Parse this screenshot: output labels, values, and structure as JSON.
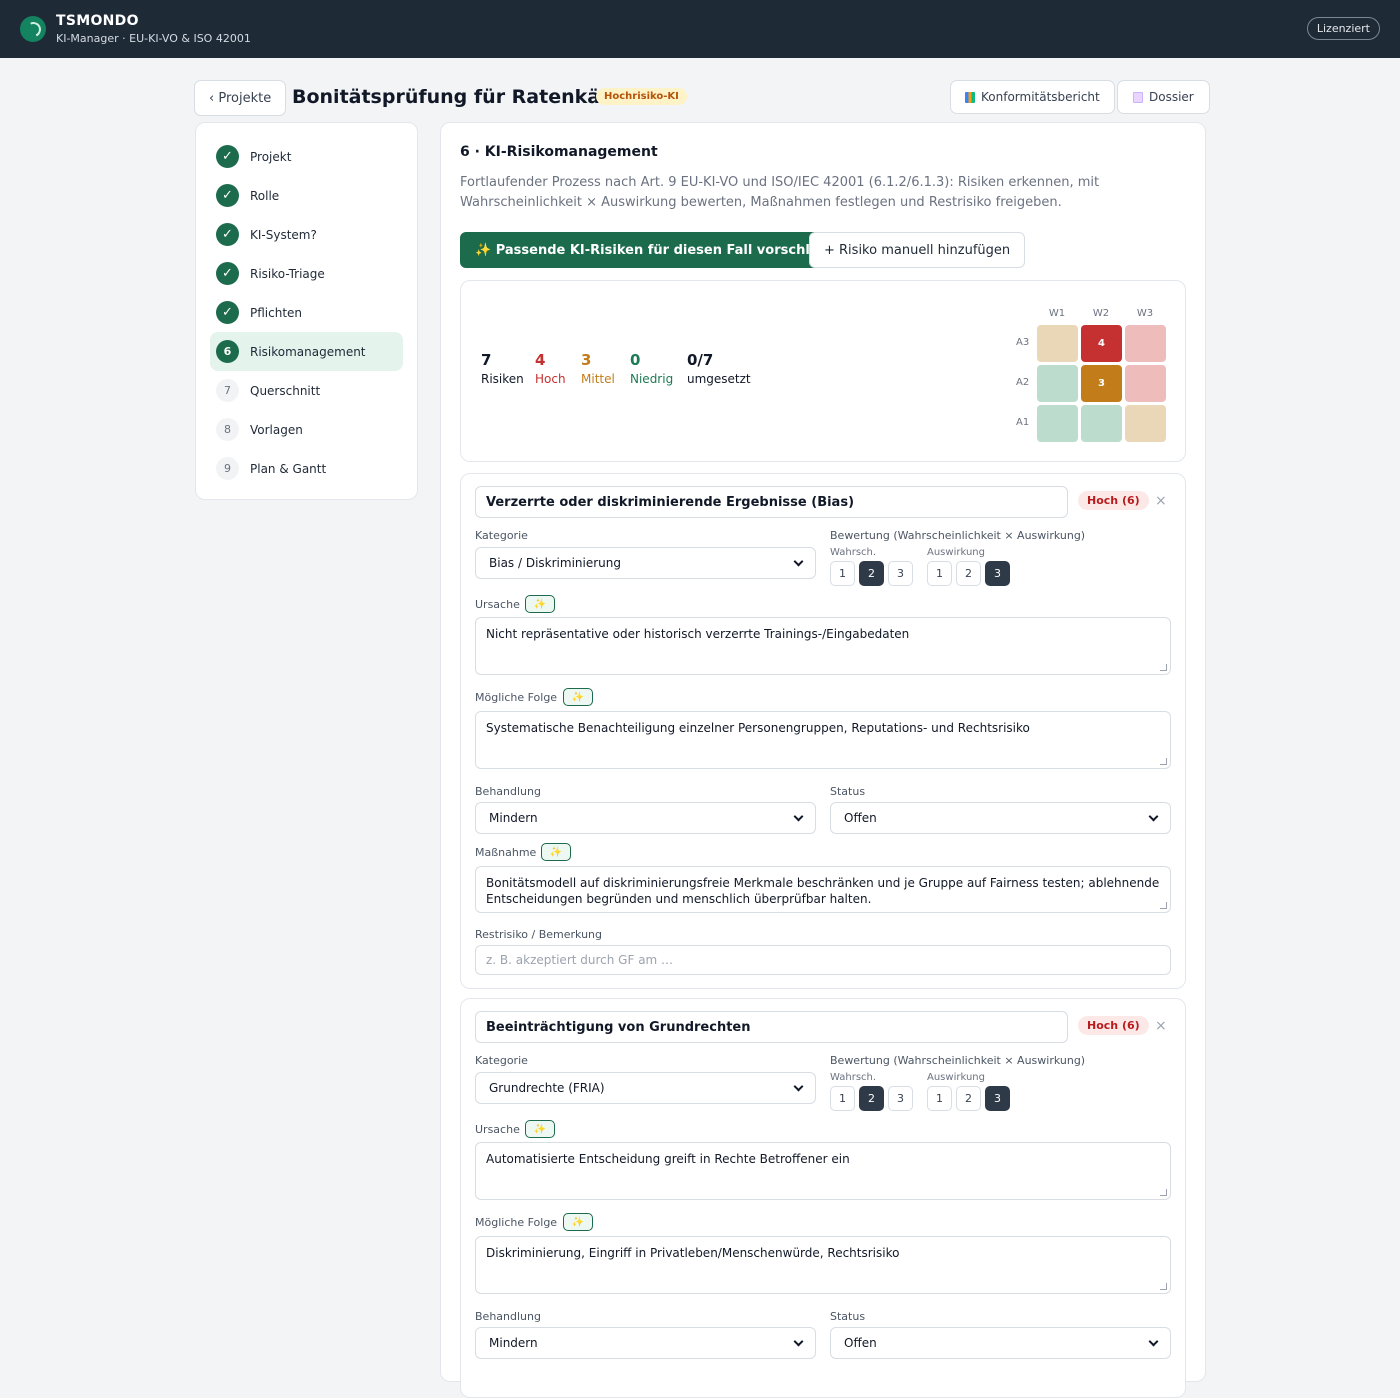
{
  "app": {
    "name": "TSMONDO",
    "subtitle": "KI-Manager · EU-KI-VO & ISO 42001",
    "license": "Lizenziert"
  },
  "header": {
    "back": "‹ Projekte",
    "title": "Bonitätsprüfung für Ratenkäufe",
    "badge": "Hochrisiko-KI",
    "report": "Konformitätsbericht",
    "dossier": "Dossier"
  },
  "steps": [
    {
      "num": "✓",
      "label": "Projekt",
      "state": "done"
    },
    {
      "num": "✓",
      "label": "Rolle",
      "state": "done"
    },
    {
      "num": "✓",
      "label": "KI-System?",
      "state": "done"
    },
    {
      "num": "✓",
      "label": "Risiko-Triage",
      "state": "done"
    },
    {
      "num": "✓",
      "label": "Pflichten",
      "state": "done"
    },
    {
      "num": "6",
      "label": "Risikomanagement",
      "state": "current"
    },
    {
      "num": "7",
      "label": "Querschnitt",
      "state": "todo"
    },
    {
      "num": "8",
      "label": "Vorlagen",
      "state": "todo"
    },
    {
      "num": "9",
      "label": "Plan & Gantt",
      "state": "todo"
    }
  ],
  "section": {
    "title": "6 · KI-Risikomanagement",
    "description": "Fortlaufender Prozess nach Art. 9 EU-KI-VO und ISO/IEC 42001 (6.1.2/6.1.3): Risiken erkennen, mit Wahrscheinlichkeit × Auswirkung bewerten, Maßnahmen festlegen und Restrisiko freigeben.",
    "suggest_btn": "✨ Passende KI-Risiken für diesen Fall vorschlagen",
    "manual_btn": "+ Risiko manuell hinzufügen"
  },
  "summary": {
    "stats": [
      {
        "value": "7",
        "label": "Risiken",
        "color": "#111827"
      },
      {
        "value": "4",
        "label": "Hoch",
        "color": "#c53030"
      },
      {
        "value": "3",
        "label": "Mittel",
        "color": "#c27d1a"
      },
      {
        "value": "0",
        "label": "Niedrig",
        "color": "#1c7a55"
      },
      {
        "value": "0/7",
        "label": "umgesetzt",
        "color": "#111827"
      }
    ],
    "matrix": {
      "cols": [
        "W1",
        "W2",
        "W3"
      ],
      "rows": [
        "A3",
        "A2",
        "A1"
      ],
      "cells": [
        [
          "",
          "4",
          ""
        ],
        [
          "",
          "3",
          ""
        ],
        [
          "",
          "",
          ""
        ]
      ],
      "colors": [
        [
          "#ead7b8",
          "#c53030",
          "#efbcbc"
        ],
        [
          "#bcdccd",
          "#c27d1a",
          "#efbcbc"
        ],
        [
          "#bcdccd",
          "#bcdccd",
          "#ead7b8"
        ]
      ]
    }
  },
  "labels": {
    "kategorie": "Kategorie",
    "bewertung": "Bewertung (Wahrscheinlichkeit × Auswirkung)",
    "wahrsch": "Wahrsch.",
    "auswirkung": "Auswirkung",
    "ursache": "Ursache",
    "folge": "Mögliche Folge",
    "behandlung": "Behandlung",
    "status": "Status",
    "massnahme": "Maßnahme",
    "restrisiko": "Restrisiko / Bemerkung",
    "spark": "✨",
    "close": "×",
    "one": "1",
    "two": "2",
    "three": "3"
  },
  "risks": [
    {
      "title": "Verzerrte oder diskriminierende Ergebnisse (Bias)",
      "level": "Hoch (6)",
      "kategorie": "Bias / Diskriminierung",
      "wahrsch": 2,
      "auswirkung": 3,
      "ursache": "Nicht repräsentative oder historisch verzerrte Trainings-/Eingabedaten",
      "folge": "Systematische Benachteiligung einzelner Personengruppen, Reputations- und Rechtsrisiko",
      "behandlung": "Mindern",
      "status": "Offen",
      "massnahme": "Bonitätsmodell auf diskriminierungsfreie Merkmale beschränken und je Gruppe auf Fairness testen; ablehnende Entscheidungen begründen und menschlich überprüfbar halten.",
      "restrisiko_placeholder": "z. B. akzeptiert durch GF am …"
    },
    {
      "title": "Beeinträchtigung von Grundrechten",
      "level": "Hoch (6)",
      "kategorie": "Grundrechte (FRIA)",
      "wahrsch": 2,
      "auswirkung": 3,
      "ursache": "Automatisierte Entscheidung greift in Rechte Betroffener ein",
      "folge": "Diskriminierung, Eingriff in Privatleben/Menschenwürde, Rechtsrisiko",
      "behandlung": "Mindern",
      "status": "Offen"
    }
  ]
}
